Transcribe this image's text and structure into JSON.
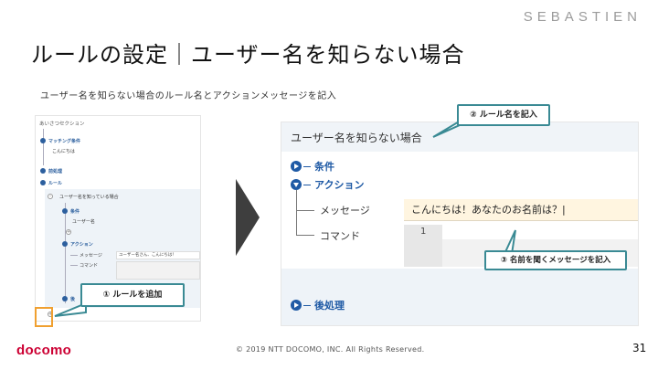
{
  "header": {
    "brand": "SEBASTIEN",
    "title": "ルールの設定｜ユーザー名を知らない場合",
    "subtitle": "ユーザー名を知らない場合のルール名とアクションメッセージを記入"
  },
  "left_screenshot": {
    "header": "あいさつセクション",
    "items": {
      "matching": "マッチング条件",
      "matching_value": "こんにちは",
      "preprocess": "前処理",
      "rule": "ルール",
      "rule_known": "ユーザー名を知っている場合",
      "condition": "条件",
      "condition_value": "ユーザー名",
      "action": "アクション",
      "message": "メッセージ",
      "message_value": "ユーザー名さん、こんにちは！",
      "command": "コマンド",
      "postprocess": "後"
    }
  },
  "callouts": {
    "c1": "① ルールを追加",
    "c2": "② ルール名を記入",
    "c3": "③ 名前を聞くメッセージを記入"
  },
  "right_screenshot": {
    "rule_name": "ユーザー名を知らない場合",
    "condition": "条件",
    "action": "アクション",
    "message_label": "メッセージ",
    "message_value": "こんにちは！あなたのお名前は？",
    "command_label": "コマンド",
    "command_line_number": "1",
    "postprocess": "後処理"
  },
  "footer": {
    "logo": "docomo",
    "copyright": "© 2019 NTT DOCOMO, INC. All Rights Reserved.",
    "page": "31"
  },
  "colors": {
    "accent_blue": "#1f5aa5",
    "callout_border": "#3a8a94",
    "highlight_orange": "#f0a030",
    "logo_red": "#cc0033"
  }
}
